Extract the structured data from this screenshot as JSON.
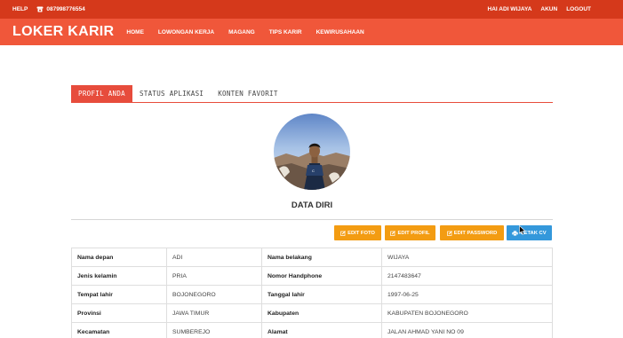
{
  "topbar": {
    "help": "HELP",
    "phone": "087998776554",
    "greeting": "HAI ADI WIJAYA",
    "account": "AKUN",
    "logout": "LOGOUT"
  },
  "navbar": {
    "brand": "LOKER KARIR",
    "items": [
      "HOME",
      "LOWONGAN KERJA",
      "MAGANG",
      "TIPS KARIR",
      "KEWIRUSAHAAN"
    ]
  },
  "tabs": [
    {
      "label": "PROFIL ANDA",
      "active": true
    },
    {
      "label": "STATUS APLIKASI",
      "active": false
    },
    {
      "label": "KONTEN FAVORIT",
      "active": false
    }
  ],
  "profile": {
    "section_title": "DATA DIRI"
  },
  "actions": {
    "edit_photo": "EDIT FOTO",
    "edit_profile": "EDIT PROFIL",
    "edit_password": "EDIT PASSWORD",
    "print_cv": "CETAK CV"
  },
  "rows": [
    {
      "label1": "Nama depan",
      "value1": "ADI",
      "label2": "Nama belakang",
      "value2": "WIJAYA"
    },
    {
      "label1": "Jenis kelamin",
      "value1": "PRIA",
      "label2": "Nomor Handphone",
      "value2": "2147483647"
    },
    {
      "label1": "Tempat lahir",
      "value1": "BOJONEGORO",
      "label2": "Tanggal lahir",
      "value2": "1997-06-25"
    },
    {
      "label1": "Provinsi",
      "value1": "JAWA TIMUR",
      "label2": "Kabupaten",
      "value2": "KABUPATEN BOJONEGORO"
    },
    {
      "label1": "Kecamatan",
      "value1": "SUMBEREJO",
      "label2": "Alamat",
      "value2": "JALAN AHMAD YANI NO 09"
    }
  ],
  "colors": {
    "topbar": "#d5391b",
    "navbar": "#f0573a",
    "tab_active": "#e74c3c",
    "btn_orange": "#f39c12",
    "btn_blue": "#3498db"
  }
}
